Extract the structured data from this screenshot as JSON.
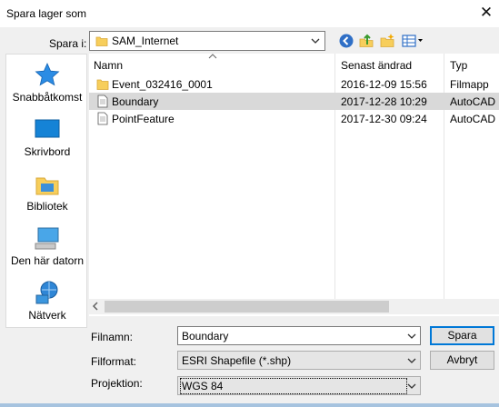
{
  "window": {
    "title": "Spara lager som",
    "close_glyph": "✕"
  },
  "toolbar": {
    "save_in_label": "Spara i:",
    "location": "SAM_Internet",
    "icons": [
      "back-icon",
      "up-folder-icon",
      "new-folder-icon",
      "view-menu-icon"
    ]
  },
  "places": [
    {
      "label": "Snabbåtkomst",
      "icon": "star-icon"
    },
    {
      "label": "Skrivbord",
      "icon": "desktop-icon"
    },
    {
      "label": "Bibliotek",
      "icon": "library-icon"
    },
    {
      "label": "Den här datorn",
      "icon": "computer-icon"
    },
    {
      "label": "Nätverk",
      "icon": "network-icon"
    }
  ],
  "columns": {
    "name": "Namn",
    "modified": "Senast ändrad",
    "type": "Typ"
  },
  "files": [
    {
      "name": "Event_032416_0001",
      "modified": "2016-12-09 15:56",
      "type": "Filmapp",
      "icon": "folder-icon",
      "selected": false
    },
    {
      "name": "Boundary",
      "modified": "2017-12-28 10:29",
      "type": "AutoCAD",
      "icon": "file-icon",
      "selected": true
    },
    {
      "name": "PointFeature",
      "modified": "2017-12-30 09:24",
      "type": "AutoCAD",
      "icon": "file-icon",
      "selected": false
    }
  ],
  "form": {
    "filename_label": "Filnamn:",
    "filename_value": "Boundary",
    "format_label": "Filformat:",
    "format_value": "ESRI Shapefile (*.shp)",
    "projection_label": "Projektion:",
    "projection_value": "WGS 84"
  },
  "buttons": {
    "save": "Spara",
    "cancel": "Avbryt"
  },
  "colors": {
    "accent": "#0078d7",
    "selection": "#d9d9d9",
    "folder": "#f7ce5b"
  }
}
